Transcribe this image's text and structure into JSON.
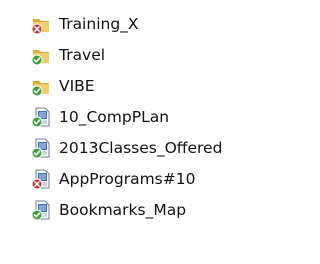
{
  "items": [
    {
      "label": "Training_X",
      "kind": "folder",
      "status": "error"
    },
    {
      "label": "Travel",
      "kind": "folder",
      "status": "ok"
    },
    {
      "label": "VIBE",
      "kind": "folder",
      "status": "ok"
    },
    {
      "label": "10_CompPLan",
      "kind": "document",
      "status": "ok"
    },
    {
      "label": "2013Classes_Offered",
      "kind": "document",
      "status": "ok"
    },
    {
      "label": "AppPrograms#10",
      "kind": "document",
      "status": "error"
    },
    {
      "label": "Bookmarks_Map",
      "kind": "document",
      "status": "ok"
    }
  ],
  "colors": {
    "folder": "#e8c35a",
    "document_blue": "#3a6fb5",
    "status_ok": "#3aa03a",
    "status_error": "#d0312d"
  }
}
